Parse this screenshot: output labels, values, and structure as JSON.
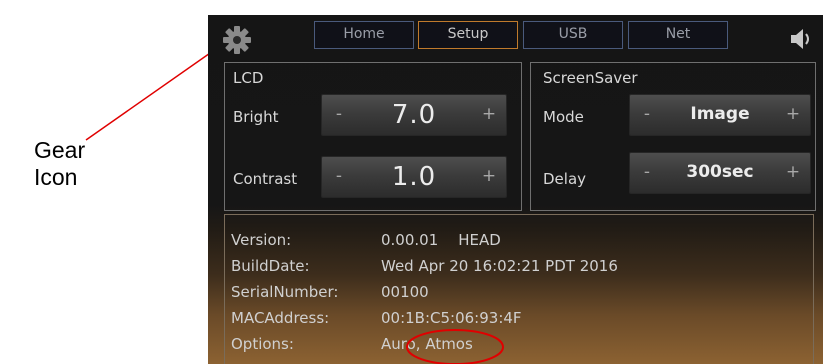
{
  "callout": {
    "line1": "Gear",
    "line2": "Icon"
  },
  "tabs": [
    {
      "label": "Home",
      "active": false
    },
    {
      "label": "Setup",
      "active": true
    },
    {
      "label": "USB",
      "active": false
    },
    {
      "label": "Net",
      "active": false
    }
  ],
  "icons": {
    "settings": "gear-icon",
    "volume": "speaker-icon"
  },
  "lcd": {
    "title": "LCD",
    "bright": {
      "label": "Bright",
      "value": "7.0"
    },
    "contrast": {
      "label": "Contrast",
      "value": "1.0"
    }
  },
  "screensaver": {
    "title": "ScreenSaver",
    "mode": {
      "label": "Mode",
      "value": "Image"
    },
    "delay": {
      "label": "Delay",
      "value": "300sec"
    }
  },
  "stepper": {
    "minus": "-",
    "plus": "+"
  },
  "info": {
    "version": {
      "label": "Version:",
      "value": "0.00.01",
      "tag": "HEAD"
    },
    "build_date": {
      "label": "BuildDate:",
      "value": "Wed Apr 20 16:02:21 PDT 2016"
    },
    "serial": {
      "label": "SerialNumber:",
      "value": "00100"
    },
    "mac": {
      "label": "MACAddress:",
      "value": "00:1B:C5:06:93:4F"
    },
    "options": {
      "label": "Options:",
      "value": "Auro, Atmos"
    }
  },
  "colors": {
    "callout_red": "#e00000",
    "active_tab_border": "#c07a2c",
    "tab_border": "#4a5a7c"
  }
}
